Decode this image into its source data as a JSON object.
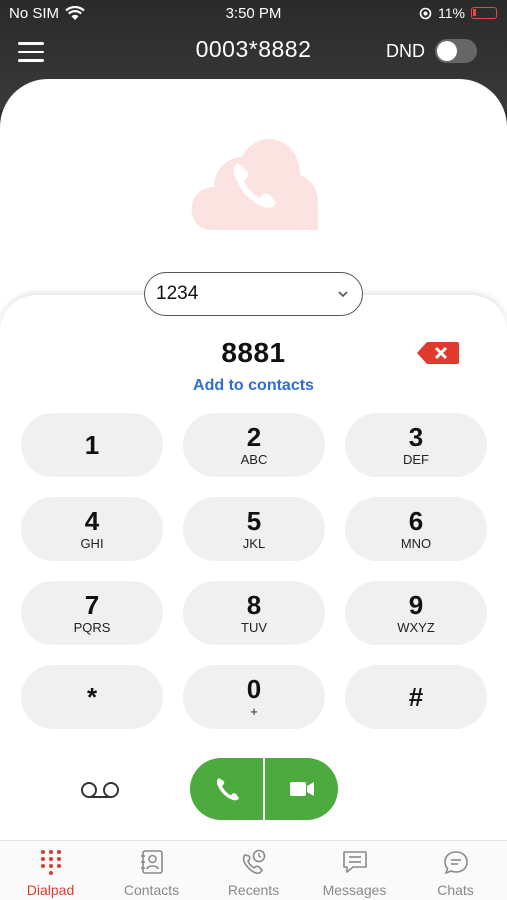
{
  "status_bar": {
    "carrier": "No SIM",
    "time": "3:50 PM",
    "battery": "11%"
  },
  "header": {
    "title": "0003*8882",
    "dnd_label": "DND",
    "dnd_enabled": false
  },
  "account_selector": {
    "value": "1234"
  },
  "dialer": {
    "number": "8881",
    "add_to_contacts": "Add to contacts"
  },
  "keys": [
    {
      "digit": "1",
      "letters": ""
    },
    {
      "digit": "2",
      "letters": "ABC"
    },
    {
      "digit": "3",
      "letters": "DEF"
    },
    {
      "digit": "4",
      "letters": "GHI"
    },
    {
      "digit": "5",
      "letters": "JKL"
    },
    {
      "digit": "6",
      "letters": "MNO"
    },
    {
      "digit": "7",
      "letters": "PQRS"
    },
    {
      "digit": "8",
      "letters": "TUV"
    },
    {
      "digit": "9",
      "letters": "WXYZ"
    },
    {
      "digit": "*",
      "letters": ""
    },
    {
      "digit": "0",
      "letters": "+"
    },
    {
      "digit": "#",
      "letters": ""
    }
  ],
  "tabs": [
    {
      "label": "Dialpad",
      "icon": "dialpad-icon",
      "active": true
    },
    {
      "label": "Contacts",
      "icon": "contacts-icon",
      "active": false
    },
    {
      "label": "Recents",
      "icon": "recents-icon",
      "active": false
    },
    {
      "label": "Messages",
      "icon": "messages-icon",
      "active": false
    },
    {
      "label": "Chats",
      "icon": "chats-icon",
      "active": false
    }
  ],
  "colors": {
    "accent_red": "#e03a2f",
    "call_green": "#4caa3e",
    "link_blue": "#2d6fd0",
    "header_dark": "#2f2f2f"
  }
}
